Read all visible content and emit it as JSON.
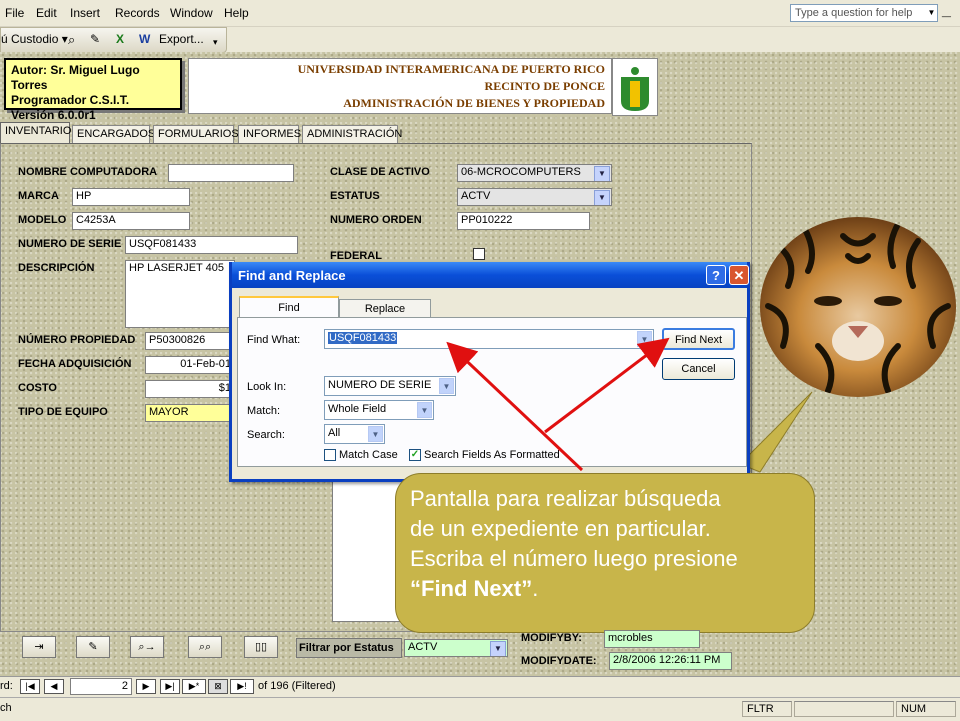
{
  "menu": [
    "File",
    "Edit",
    "Insert",
    "Records",
    "Window",
    "Help"
  ],
  "ask_placeholder": "Type a question for help",
  "toolbar": {
    "custodio": "ú Custodio",
    "export": "Export..."
  },
  "header": {
    "author_lines": [
      "Autor:  Sr. Miguel Lugo Torres",
      "Programador C.S.I.T.",
      "Versión 6.0.0r1"
    ],
    "line1": "UNIVERSIDAD INTERAMERICANA DE PUERTO RICO",
    "line2": "RECINTO DE PONCE",
    "line3": "ADMINISTRACIÓN DE BIENES Y PROPIEDAD"
  },
  "tabs": [
    "INVENTARIO",
    "ENCARGADOS",
    "FORMULARIOS",
    "INFORMES",
    "ADMINISTRACIÓN"
  ],
  "fields": {
    "nombre_computadora": {
      "label": "NOMBRE COMPUTADORA",
      "value": ""
    },
    "marca": {
      "label": "MARCA",
      "value": "HP"
    },
    "modelo": {
      "label": "MODELO",
      "value": "C4253A"
    },
    "numero_serie": {
      "label": "NUMERO DE SERIE",
      "value": "USQF081433"
    },
    "descripcion": {
      "label": "DESCRIPCIÓN",
      "value": "HP LASERJET 405"
    },
    "numero_propiedad": {
      "label": "NÚMERO PROPIEDAD",
      "value": "P50300826"
    },
    "fecha_adquisicion": {
      "label": "FECHA ADQUISICIÓN",
      "value": "01-Feb-01"
    },
    "costo": {
      "label": "COSTO",
      "value": "$1"
    },
    "tipo_equipo": {
      "label": "TIPO DE EQUIPO",
      "value": "MAYOR"
    },
    "clase_activo": {
      "label": "CLASE DE ACTIVO",
      "value": "06-MCROCOMPUTERS"
    },
    "estatus": {
      "label": "ESTATUS",
      "value": "ACTV"
    },
    "numero_orden": {
      "label": "NUMERO ORDEN",
      "value": "PP010222"
    },
    "federal": {
      "label": "FEDERAL"
    }
  },
  "dialog": {
    "title": "Find and Replace",
    "help_glyph": "?",
    "close_glyph": "✕",
    "tab_find": "Find",
    "tab_replace": "Replace",
    "find_what_label": "Find What:",
    "find_what_value": "USQF081433",
    "look_in_label": "Look In:",
    "look_in_value": "NUMERO DE SERIE",
    "match_label": "Match:",
    "match_value": "Whole Field",
    "search_label": "Search:",
    "search_value": "All",
    "match_case": "Match Case",
    "search_formatted": "Search Fields As Formatted",
    "find_next": "Find Next",
    "cancel": "Cancel"
  },
  "callout": {
    "line1": "Pantalla para realizar búsqueda",
    "line2": "de un expediente en particular.",
    "line3": "Escriba el número luego presione",
    "line4_bold": "“Find Next”",
    "line4_end": "."
  },
  "bottom": {
    "filter_label": "Filtrar por Estatus",
    "filter_value": "ACTV",
    "modifyby_label": "MODIFYBY:",
    "modifyby_value": "mcrobles",
    "modifydate_label": "MODIFYDATE:",
    "modifydate_value": "2/8/2006 12:26:11 PM"
  },
  "navigation": {
    "label": "rd:",
    "current": "2",
    "of_text": "of  196 (Filtered)"
  },
  "status": {
    "left": "ch",
    "fltr": "FLTR",
    "num": "NUM"
  },
  "colors": {
    "callout": "#c8b54a",
    "title_bar": "#0a4fd8",
    "arrow": "#e01010",
    "author_bg": "#ffff99"
  }
}
